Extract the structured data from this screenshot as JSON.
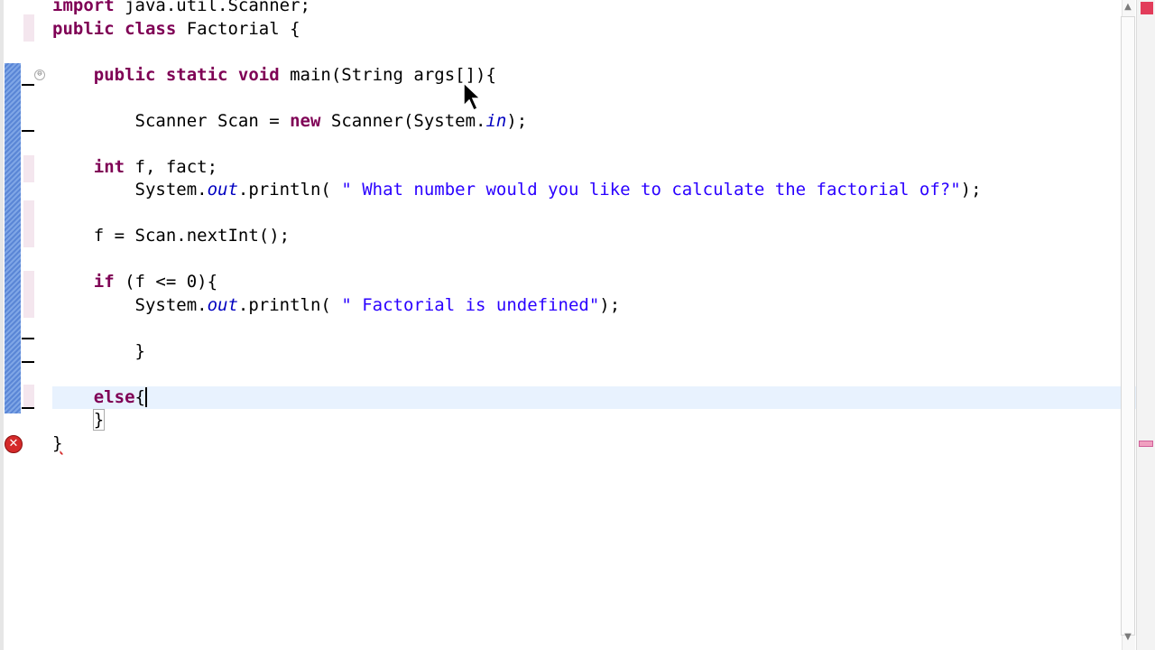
{
  "editor": {
    "language": "java",
    "lines": [
      {
        "segments": [
          {
            "t": "import",
            "c": "kw-plain"
          },
          {
            "t": " java.util.Scanner;",
            "c": ""
          }
        ]
      },
      {
        "segments": [
          {
            "t": "public class",
            "c": "kw-plain"
          },
          {
            "t": " Factorial {",
            "c": ""
          }
        ]
      },
      {
        "segments": [
          {
            "t": "",
            "c": ""
          }
        ]
      },
      {
        "segments": [
          {
            "t": "    ",
            "c": ""
          },
          {
            "t": "public static void",
            "c": "kw-plain"
          },
          {
            "t": " main(String args[]){",
            "c": ""
          }
        ]
      },
      {
        "segments": [
          {
            "t": "",
            "c": ""
          }
        ]
      },
      {
        "segments": [
          {
            "t": "        Scanner Scan = ",
            "c": ""
          },
          {
            "t": "new",
            "c": "kw-plain"
          },
          {
            "t": " Scanner(System.",
            "c": ""
          },
          {
            "t": "in",
            "c": "ital"
          },
          {
            "t": ");",
            "c": ""
          }
        ]
      },
      {
        "segments": [
          {
            "t": "",
            "c": ""
          }
        ]
      },
      {
        "segments": [
          {
            "t": "    ",
            "c": ""
          },
          {
            "t": "int",
            "c": "kw-plain"
          },
          {
            "t": " f, fact;",
            "c": ""
          }
        ]
      },
      {
        "segments": [
          {
            "t": "        System.",
            "c": ""
          },
          {
            "t": "out",
            "c": "ital"
          },
          {
            "t": ".println( ",
            "c": ""
          },
          {
            "t": "\" What number would you like to calculate the factorial of?\"",
            "c": "str"
          },
          {
            "t": ");",
            "c": ""
          }
        ]
      },
      {
        "segments": [
          {
            "t": "",
            "c": ""
          }
        ]
      },
      {
        "segments": [
          {
            "t": "    f = Scan.nextInt();",
            "c": ""
          }
        ]
      },
      {
        "segments": [
          {
            "t": "",
            "c": ""
          }
        ]
      },
      {
        "segments": [
          {
            "t": "    ",
            "c": ""
          },
          {
            "t": "if",
            "c": "kw-plain"
          },
          {
            "t": " (f <= 0){",
            "c": ""
          }
        ]
      },
      {
        "segments": [
          {
            "t": "        System.",
            "c": ""
          },
          {
            "t": "out",
            "c": "ital"
          },
          {
            "t": ".println( ",
            "c": ""
          },
          {
            "t": "\" Factorial is undefined\"",
            "c": "str"
          },
          {
            "t": ");",
            "c": ""
          }
        ]
      },
      {
        "segments": [
          {
            "t": "",
            "c": ""
          }
        ]
      },
      {
        "segments": [
          {
            "t": "        }",
            "c": ""
          }
        ]
      },
      {
        "segments": [
          {
            "t": "",
            "c": ""
          }
        ]
      },
      {
        "segments": [
          {
            "t": "    ",
            "c": ""
          },
          {
            "t": "else",
            "c": "kw-plain"
          },
          {
            "t": "{",
            "c": ""
          }
        ],
        "current": true,
        "caret": true
      },
      {
        "segments": [
          {
            "t": "    ",
            "c": ""
          },
          {
            "t": "}",
            "c": "bracket"
          }
        ]
      },
      {
        "segments": [
          {
            "t": "}",
            "c": "err"
          }
        ]
      }
    ]
  },
  "markers": {
    "error_icon": "error-x-icon",
    "fold_toggle": "⊖",
    "scroll_up": "▲",
    "scroll_down": "▼"
  },
  "colors": {
    "keyword": "#7f0055",
    "string": "#2a00ff",
    "static_field": "#0000c0",
    "current_line": "#e8f2fe",
    "error": "#d42a2a"
  }
}
